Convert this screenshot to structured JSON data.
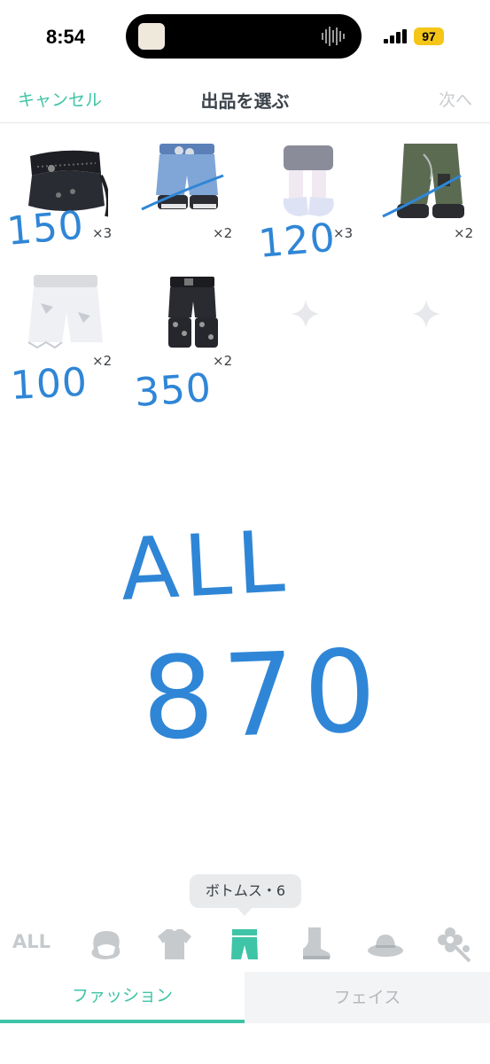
{
  "status": {
    "time": "8:54",
    "battery": "97"
  },
  "nav": {
    "cancel": "キャンセル",
    "title": "出品を選ぶ",
    "next": "次へ"
  },
  "items": [
    {
      "name": "black-studded-skirt",
      "qty": "×3",
      "price": "150"
    },
    {
      "name": "blue-denim-shorts",
      "qty": "×2",
      "price": ""
    },
    {
      "name": "gray-skirt-white-boots",
      "qty": "×3",
      "price": "120"
    },
    {
      "name": "green-cargo-pants",
      "qty": "×2",
      "price": ""
    },
    {
      "name": "white-distressed-shorts",
      "qty": "×2",
      "price": "100"
    },
    {
      "name": "black-studded-shorts",
      "qty": "×2",
      "price": "350"
    }
  ],
  "handwriting": {
    "all": "ALL",
    "total": "870"
  },
  "tooltip": "ボトムス・6",
  "categories": {
    "all": "ALL"
  },
  "tabs": {
    "fashion": "ファッション",
    "face": "フェイス"
  },
  "colors": {
    "accent": "#3ec4a6",
    "ink": "#2f86d6"
  }
}
